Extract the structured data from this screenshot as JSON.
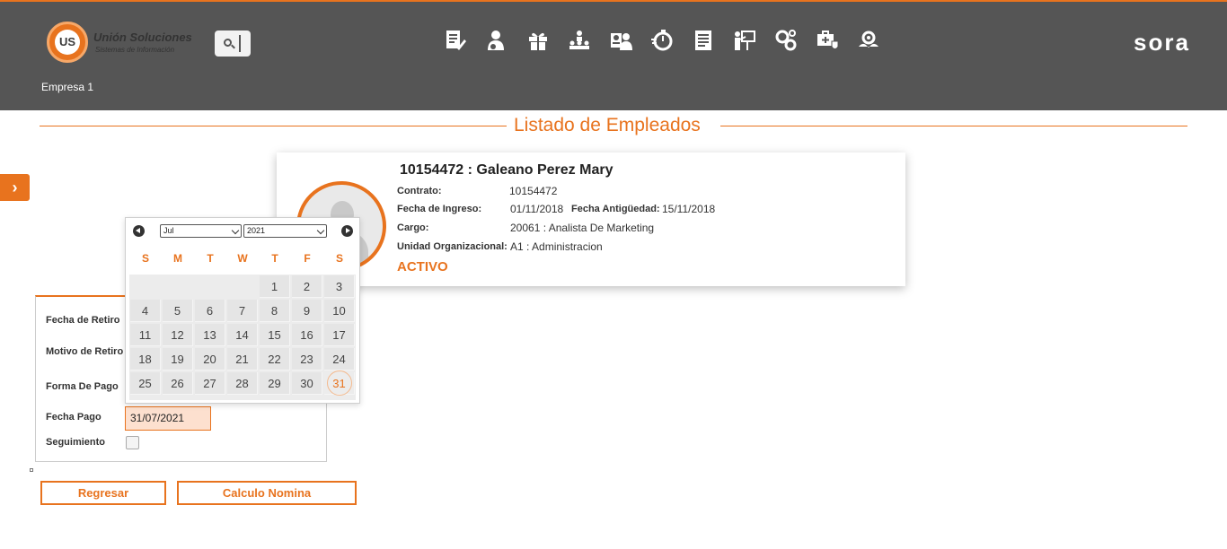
{
  "header": {
    "logo_title": "Unión Soluciones",
    "logo_subtitle": "Sistemas de Información",
    "logo_mark": "US",
    "brand": "sora",
    "company": "Empresa 1",
    "nav_icons": [
      "document-edit-icon",
      "employee-icon",
      "gift-icon",
      "org-chart-icon",
      "employee-card-icon",
      "timer-icon",
      "report-icon",
      "training-icon",
      "settings-gears-icon",
      "health-check-icon",
      "recognition-icon"
    ]
  },
  "page": {
    "title": "Listado de Empleados"
  },
  "employee": {
    "name": "10154472 : Galeano Perez Mary",
    "contract_label": "Contrato:",
    "contract_value": "10154472",
    "hire_date_label": "Fecha de Ingreso:",
    "hire_date_value": "01/11/2018",
    "seniority_label": "Fecha Antigüedad:",
    "seniority_value": "15/11/2018",
    "position_label": "Cargo:",
    "position_value": "20061 : Analista De Marketing",
    "org_unit_label": "Unidad Organizacional:",
    "org_unit_value": "A1 : Administracion",
    "status": "ACTIVO"
  },
  "form": {
    "retiro_date_label": "Fecha de Retiro",
    "retiro_reason_label": "Motivo de Retiro",
    "payment_method_label": "Forma De Pago",
    "payment_date_label": "Fecha Pago",
    "payment_date_value": "31/07/2021",
    "followup_label": "Seguimiento"
  },
  "buttons": {
    "back": "Regresar",
    "calc": "Calculo Nomina"
  },
  "datepicker": {
    "month": "Jul",
    "year": "2021",
    "weekdays": [
      "S",
      "M",
      "T",
      "W",
      "T",
      "F",
      "S"
    ],
    "weeks": [
      [
        "",
        "",
        "",
        "",
        "1",
        "2",
        "3"
      ],
      [
        "4",
        "5",
        "6",
        "7",
        "8",
        "9",
        "10"
      ],
      [
        "11",
        "12",
        "13",
        "14",
        "15",
        "16",
        "17"
      ],
      [
        "18",
        "19",
        "20",
        "21",
        "22",
        "23",
        "24"
      ],
      [
        "25",
        "26",
        "27",
        "28",
        "29",
        "30",
        "31"
      ]
    ],
    "selected": "31"
  },
  "colors": {
    "accent": "#e8731e",
    "header_bg": "#555555"
  }
}
